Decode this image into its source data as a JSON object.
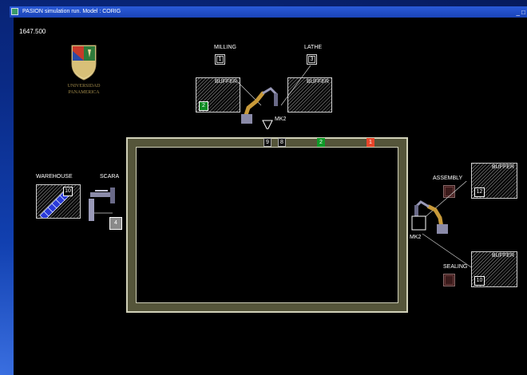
{
  "window": {
    "title": "PASION simulation run. Model : CORIG",
    "sys_buttons": "_ □"
  },
  "sim_time": "1647.500",
  "logo": {
    "line1": "UNIVERSIDAD",
    "line2": "PANAMERICA"
  },
  "labels": {
    "milling": "MILLING",
    "lathe": "LATHE",
    "mk2_top": "MK2",
    "mk2_right": "MK2",
    "warehouse": "WAREHOUSE",
    "scara": "SCARA",
    "assembly": "ASSEMBLY",
    "sealing": "SEALING"
  },
  "buffers": {
    "top_left": {
      "title": "BUFFER",
      "count": "2"
    },
    "top_right": {
      "title": "BUFFER"
    },
    "right_top": {
      "title": "BUFFER",
      "count": "12"
    },
    "right_bottom": {
      "title": "BUFFER",
      "count": "10"
    }
  },
  "stations": {
    "milling": "1",
    "lathe": "3"
  },
  "warehouse_count": "10",
  "scara_count": "4",
  "pallets": [
    "9",
    "8",
    "2",
    "1"
  ],
  "colors": {
    "conveyor": "#d0d0b8",
    "belt": "#55553a",
    "green": "#0f9a28",
    "red": "#e8452a"
  }
}
